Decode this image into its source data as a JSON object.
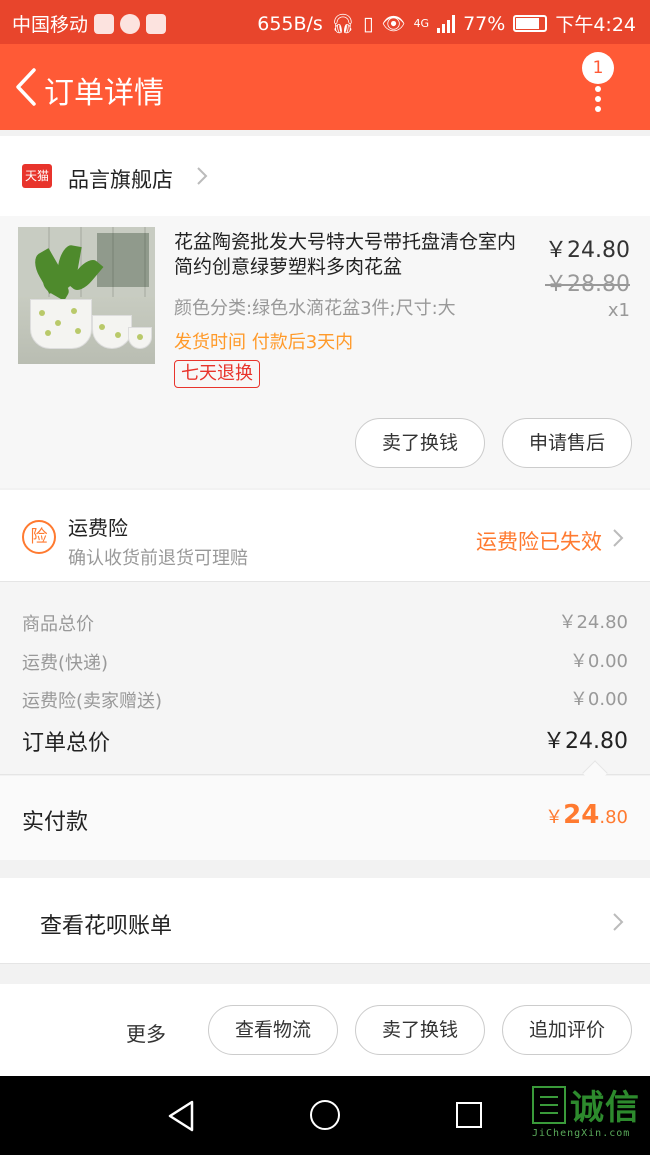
{
  "status_bar": {
    "carrier": "中国移动",
    "speed": "655B/s",
    "network": "4G",
    "battery_percent": "77%",
    "battery_level": 0.77,
    "time": "下午4:24"
  },
  "header": {
    "title": "订单详情",
    "notification_count": "1",
    "accent_color": "#ff5a36"
  },
  "shop": {
    "badge": "天猫",
    "name": "品言旗舰店"
  },
  "product": {
    "title": "花盆陶瓷批发大号特大号带托盘清仓室内简约创意绿萝塑料多肉花盆",
    "spec": "颜色分类:绿色水滴花盆3件;尺寸:大",
    "ship_time": "发货时间  付款后3天内",
    "return_tag": "七天退换",
    "price": "￥24.80",
    "original_price": "￥28.80",
    "quantity": "x1",
    "buttons": [
      "卖了换钱",
      "申请售后"
    ]
  },
  "insurance": {
    "icon_text": "险",
    "title": "运费险",
    "subtitle": "确认收货前退货可理赔",
    "status": "运费险已失效"
  },
  "totals": {
    "rows": [
      {
        "label": "商品总价",
        "value": "￥24.80"
      },
      {
        "label": "运费(快递)",
        "value": "￥0.00"
      },
      {
        "label": "运费险(卖家赠送)",
        "value": "￥0.00"
      }
    ],
    "order_total_label": "订单总价",
    "order_total_value": "￥24.80"
  },
  "paid": {
    "label": "实付款",
    "symbol": "￥",
    "integer": "24",
    "decimal": ".80"
  },
  "huabei": {
    "label": "查看花呗账单"
  },
  "actions": {
    "more": "更多",
    "buttons": [
      "查看物流",
      "卖了换钱",
      "追加评价"
    ]
  },
  "watermark": {
    "text": "诚信",
    "subtext": "JiChengXin.com"
  }
}
